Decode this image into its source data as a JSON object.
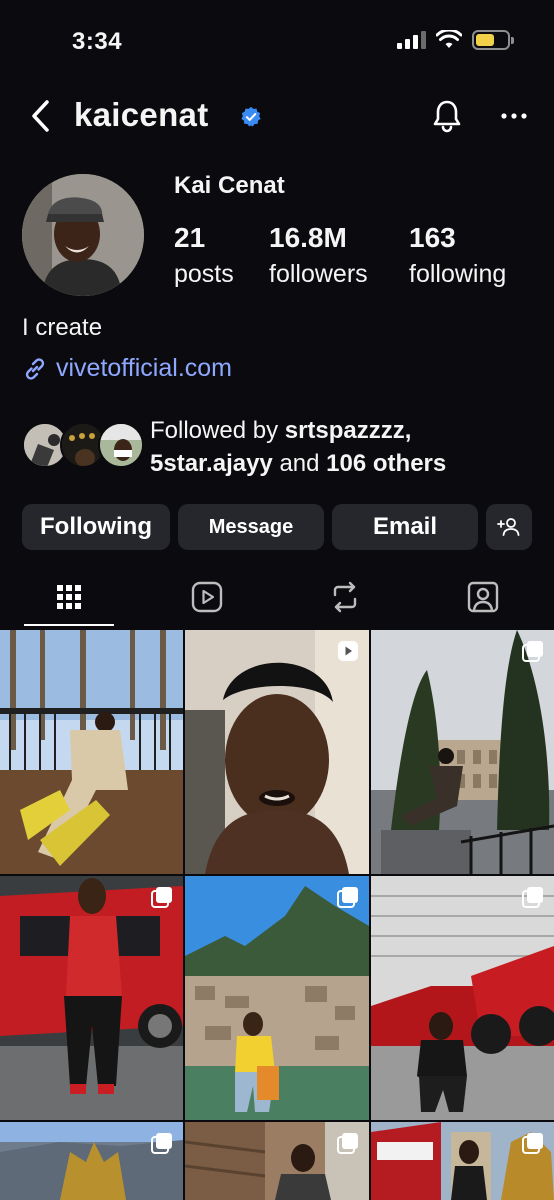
{
  "status_bar": {
    "time": "3:34",
    "battery_level": 0.6,
    "battery_color": "#f2d14a"
  },
  "header": {
    "username": "kaicenat",
    "verified_icon": "verified-badge-icon",
    "back_icon": "chevron-left-icon",
    "bell_icon": "bell-icon",
    "more_icon": "more-horizontal-icon"
  },
  "profile": {
    "display_name": "Kai Cenat",
    "stats": [
      {
        "value": "21",
        "label": "posts"
      },
      {
        "value": "16.8M",
        "label": "followers"
      },
      {
        "value": "163",
        "label": "following"
      }
    ],
    "bio": "I create",
    "link": "vivetofficial.com",
    "followed_by": {
      "prefix": "Followed by",
      "user1": "srtspazzzz,",
      "user2": "5star.ajayy",
      "middle": "and",
      "others": "106 others"
    }
  },
  "actions": {
    "following": "Following",
    "message": "Message",
    "email": "Email",
    "add_person_icon": "add-person-icon"
  },
  "tabs": [
    {
      "icon": "grid-icon",
      "active": true
    },
    {
      "icon": "reels-icon",
      "active": false
    },
    {
      "icon": "repost-icon",
      "active": false
    },
    {
      "icon": "tagged-icon",
      "active": false
    }
  ],
  "accent_link_color": "#8ea8ff",
  "button_color": "#26272c"
}
